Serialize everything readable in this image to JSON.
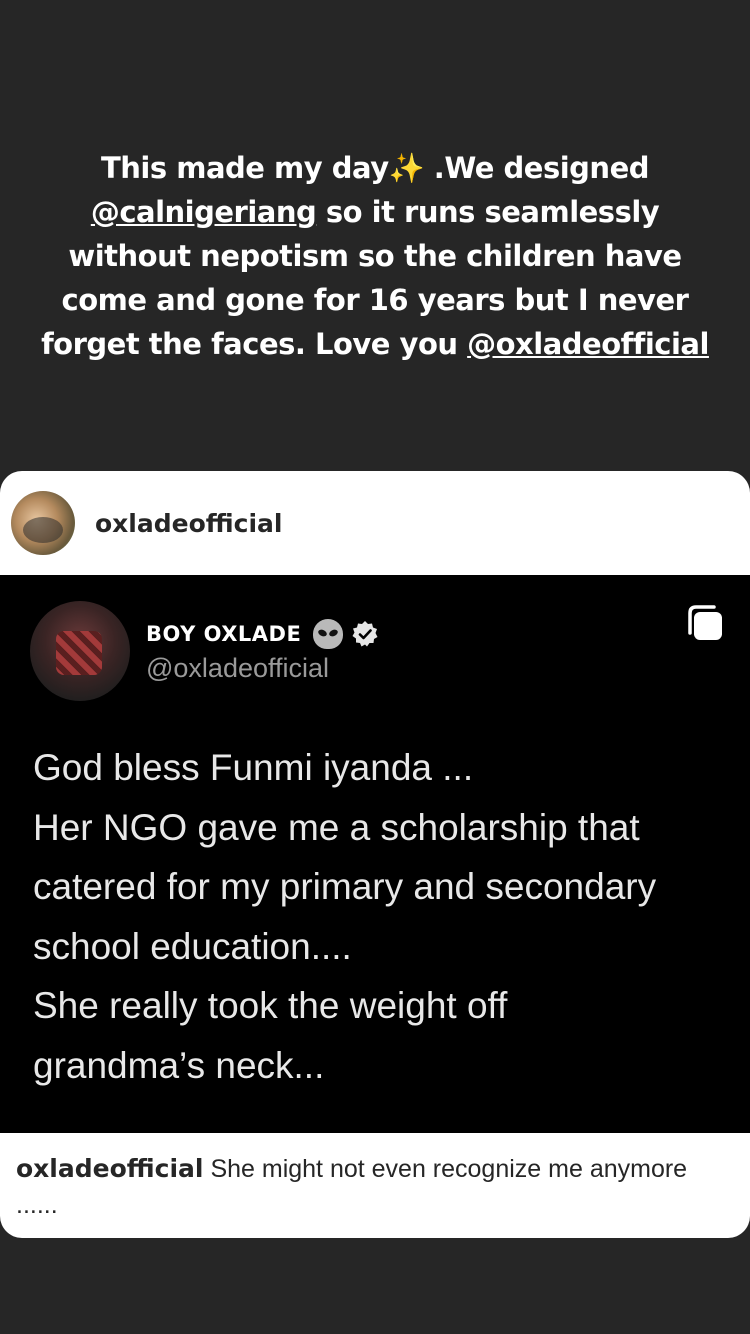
{
  "story": {
    "caption": {
      "part1": "This made my day",
      "sparkle": "✨",
      "part2": " .We designed ",
      "mention1": "@calnigeriang",
      "part3": " so it runs seamlessly without nepotism so the children have come and gone for 16 years but I never forget the faces. Love you ",
      "mention2": "@oxladeofficial"
    }
  },
  "post": {
    "username": "oxladeofficial",
    "avatar_icon": "profile-photo",
    "tweet": {
      "display_name": "BOY OXLADE",
      "emoji": "alien-icon",
      "verified": true,
      "handle": "@oxladeofficial",
      "lines": [
        "God bless Funmi iyanda ...",
        "Her NGO gave me a scholarship that",
        "catered for my primary and secondary",
        "school education....",
        "She really took the weight off",
        "grandma’s neck..."
      ]
    },
    "caption": {
      "username": "oxladeofficial",
      "text": "She might not even recognize me anymore ......"
    }
  },
  "colors": {
    "background": "#262626",
    "card": "#ffffff",
    "tweet_bg": "#000000",
    "handle_gray": "#9a9a9a"
  }
}
